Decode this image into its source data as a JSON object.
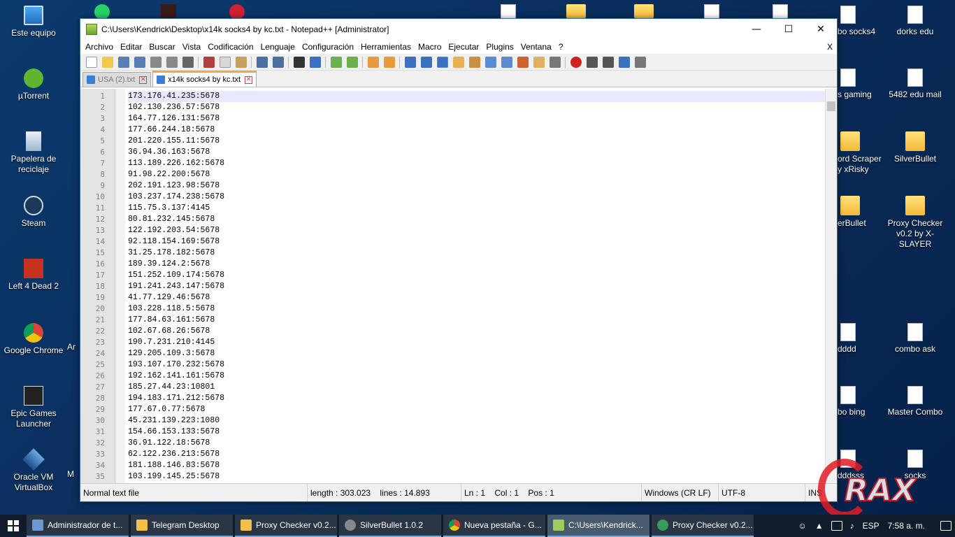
{
  "desktop": {
    "left_icons": [
      {
        "label": "Este equipo"
      },
      {
        "label": "µTorrent"
      },
      {
        "label": "Papelera de reciclaje"
      },
      {
        "label": "Steam"
      },
      {
        "label": "Left 4 Dead 2"
      },
      {
        "label": "Google Chrome"
      },
      {
        "label": "Epic Games Launcher"
      },
      {
        "label": "Oracle VM VirtualBox"
      }
    ],
    "right_partial_labels": [
      "bo socks4",
      "s gaming",
      "ord Scraper",
      "y xRisky",
      "erBullet",
      "dddd",
      "bo bing",
      "dddsss"
    ],
    "right_icons": [
      {
        "label": "dorks edu"
      },
      {
        "label": "5482 edu mail"
      },
      {
        "label": "SilverBullet"
      },
      {
        "label": "Proxy Checker v0.2 by X-SLAYER"
      },
      {
        "label": "combo ask"
      },
      {
        "label": "Master Combo"
      },
      {
        "label": "socks"
      }
    ],
    "partial_left_labels": [
      "Ar",
      "M"
    ]
  },
  "window": {
    "title": "C:\\Users\\Kendrick\\Desktop\\x14k socks4 by kc.txt - Notepad++ [Administrator]",
    "minimize": "—",
    "maximize": "☐",
    "close": "✕",
    "menu": [
      "Archivo",
      "Editar",
      "Buscar",
      "Vista",
      "Codificación",
      "Lenguaje",
      "Configuración",
      "Herramientas",
      "Macro",
      "Ejecutar",
      "Plugins",
      "Ventana",
      "?"
    ],
    "menu_close": "X",
    "tabs": [
      {
        "label": "USA (2).txt",
        "active": false
      },
      {
        "label": "x14k socks4 by kc.txt",
        "active": true
      }
    ],
    "tab_close": "✕"
  },
  "editor": {
    "lines": [
      "173.176.41.235:5678",
      "102.130.236.57:5678",
      "164.77.126.131:5678",
      "177.66.244.18:5678",
      "201.220.155.11:5678",
      "36.94.36.163:5678",
      "113.189.226.162:5678",
      "91.98.22.200:5678",
      "202.191.123.98:5678",
      "103.237.174.238:5678",
      "115.75.3.137:4145",
      "80.81.232.145:5678",
      "122.192.203.54:5678",
      "92.118.154.169:5678",
      "31.25.178.182:5678",
      "189.39.124.2:5678",
      "151.252.109.174:5678",
      "191.241.243.147:5678",
      "41.77.129.46:5678",
      "103.228.118.5:5678",
      "177.84.63.161:5678",
      "102.67.68.26:5678",
      "190.7.231.210:4145",
      "129.205.109.3:5678",
      "193.107.170.232:5678",
      "192.162.141.161:5678",
      "185.27.44.23:10801",
      "194.183.171.212:5678",
      "177.67.0.77:5678",
      "45.231.139.223:1080",
      "154.66.153.133:5678",
      "36.91.122.18:5678",
      "62.122.236.213:5678",
      "181.188.146.83:5678",
      "103.199.145.25:5678"
    ],
    "line_numbers": [
      "1",
      "2",
      "3",
      "4",
      "5",
      "6",
      "7",
      "8",
      "9",
      "10",
      "11",
      "12",
      "13",
      "14",
      "15",
      "16",
      "17",
      "18",
      "19",
      "20",
      "21",
      "22",
      "23",
      "24",
      "25",
      "26",
      "27",
      "28",
      "29",
      "30",
      "31",
      "32",
      "33",
      "34",
      "35"
    ]
  },
  "statusbar": {
    "file_type": "Normal text file",
    "length": "length : 303.023",
    "lines": "lines : 14.893",
    "ln": "Ln : 1",
    "col": "Col : 1",
    "pos": "Pos : 1",
    "eol": "Windows (CR LF)",
    "encoding": "UTF-8",
    "mode": "INS"
  },
  "watermark": {
    "text": "RAX"
  },
  "taskbar": {
    "tasks": [
      {
        "label": "Administrador de t...",
        "active": false
      },
      {
        "label": "Telegram Desktop",
        "active": false
      },
      {
        "label": "Proxy Checker v0.2...",
        "active": false
      },
      {
        "label": "SilverBullet 1.0.2",
        "active": false
      },
      {
        "label": "Nueva pestaña - G...",
        "active": false
      },
      {
        "label": "C:\\Users\\Kendrick...",
        "active": true
      },
      {
        "label": "Proxy Checker v0.2...",
        "active": false
      }
    ],
    "language": "ESP",
    "time": "7:58 a. m.",
    "colors": {
      "background": "#101c2c",
      "active_task": "#4a5a6e"
    }
  },
  "colors": {
    "desktop_bg": "#0a2f5e",
    "gutter_bg": "#e4e4e4",
    "current_line": "#e8e8ff",
    "tab_accent": "#f5a742",
    "watermark": "#e21b24"
  }
}
